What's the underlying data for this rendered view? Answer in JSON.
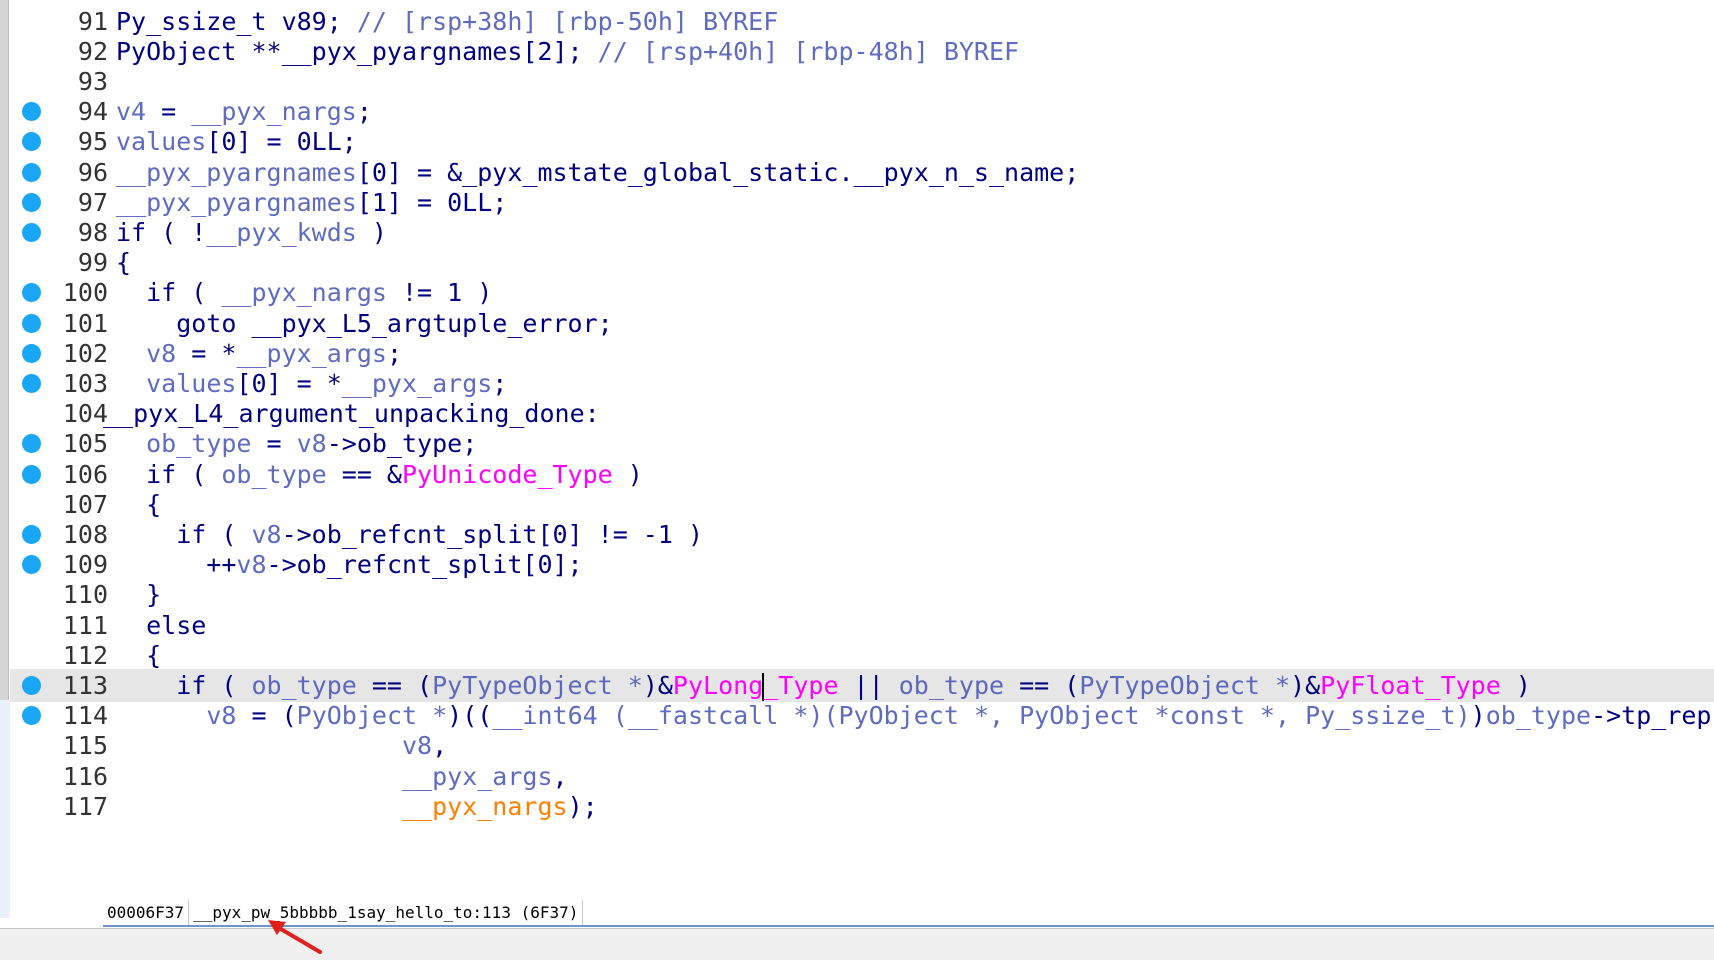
{
  "status_bar": {
    "address": "00006F37",
    "location": "__pyx_pw_5bbbbb_1say_hello_to:113 (6F37)"
  },
  "colors": {
    "breakpoint": "#19a7f5",
    "keyword": "#000080",
    "variable": "#4a57b8",
    "type_name": "#ff00ff",
    "argument": "#ff7f00",
    "current_line": "#e6e6e6"
  },
  "code_lines": [
    {
      "n": "91",
      "bp": false,
      "tokens": [
        [
          "Py_ssize_t v89; ",
          "kw"
        ],
        [
          "// [rsp+38h] [rbp-50h] BYREF",
          "com"
        ]
      ]
    },
    {
      "n": "92",
      "bp": false,
      "tokens": [
        [
          "PyObject **__pyx_pyargnames[2]; ",
          "kw"
        ],
        [
          "// [rsp+40h] [rbp-48h] BYREF",
          "com"
        ]
      ]
    },
    {
      "n": "93",
      "bp": false,
      "tokens": []
    },
    {
      "n": "94",
      "bp": true,
      "tokens": [
        [
          "v4",
          "var"
        ],
        [
          " = ",
          "kw"
        ],
        [
          "__pyx_nargs",
          "var"
        ],
        [
          ";",
          "kw"
        ]
      ]
    },
    {
      "n": "95",
      "bp": true,
      "tokens": [
        [
          "values",
          "var"
        ],
        [
          "[0] = 0LL;",
          "kw"
        ]
      ]
    },
    {
      "n": "96",
      "bp": true,
      "tokens": [
        [
          "__pyx_pyargnames",
          "var"
        ],
        [
          "[0] = &_pyx_mstate_global_static.__pyx_n_s_name;",
          "kw"
        ]
      ]
    },
    {
      "n": "97",
      "bp": true,
      "tokens": [
        [
          "__pyx_pyargnames",
          "var"
        ],
        [
          "[1] = 0LL;",
          "kw"
        ]
      ]
    },
    {
      "n": "98",
      "bp": true,
      "tokens": [
        [
          "if ( !",
          "kw"
        ],
        [
          "__pyx_kwds",
          "var"
        ],
        [
          " )",
          "kw"
        ]
      ]
    },
    {
      "n": "99",
      "bp": false,
      "tokens": [
        [
          "{",
          "kw"
        ]
      ]
    },
    {
      "n": "100",
      "bp": true,
      "tokens": [
        [
          "  if ( ",
          "kw"
        ],
        [
          "__pyx_nargs",
          "var"
        ],
        [
          " != 1 )",
          "kw"
        ]
      ]
    },
    {
      "n": "101",
      "bp": true,
      "tokens": [
        [
          "    goto __pyx_L5_argtuple_error;",
          "kw"
        ]
      ]
    },
    {
      "n": "102",
      "bp": true,
      "tokens": [
        [
          "  ",
          "kw"
        ],
        [
          "v8",
          "var"
        ],
        [
          " = *",
          "kw"
        ],
        [
          "__pyx_args",
          "var"
        ],
        [
          ";",
          "kw"
        ]
      ]
    },
    {
      "n": "103",
      "bp": true,
      "tokens": [
        [
          "  ",
          "kw"
        ],
        [
          "values",
          "var"
        ],
        [
          "[0] = *",
          "kw"
        ],
        [
          "__pyx_args",
          "var"
        ],
        [
          ";",
          "kw"
        ]
      ]
    },
    {
      "n": "104",
      "bp": false,
      "label": true,
      "tokens": [
        [
          "__pyx_L4_argument_unpacking_done:",
          "kw"
        ]
      ]
    },
    {
      "n": "105",
      "bp": true,
      "tokens": [
        [
          "  ",
          "kw"
        ],
        [
          "ob_type",
          "var"
        ],
        [
          " = ",
          "kw"
        ],
        [
          "v8",
          "var"
        ],
        [
          "->ob_type;",
          "kw"
        ]
      ]
    },
    {
      "n": "106",
      "bp": true,
      "tokens": [
        [
          "  if ( ",
          "kw"
        ],
        [
          "ob_type",
          "var"
        ],
        [
          " == &",
          "kw"
        ],
        [
          "PyUnicode_Type",
          "type"
        ],
        [
          " )",
          "kw"
        ]
      ]
    },
    {
      "n": "107",
      "bp": false,
      "tokens": [
        [
          "  {",
          "kw"
        ]
      ]
    },
    {
      "n": "108",
      "bp": true,
      "tokens": [
        [
          "    if ( ",
          "kw"
        ],
        [
          "v8",
          "var"
        ],
        [
          "->ob_refcnt_split[0] != -1 )",
          "kw"
        ]
      ]
    },
    {
      "n": "109",
      "bp": true,
      "tokens": [
        [
          "      ++",
          "kw"
        ],
        [
          "v8",
          "var"
        ],
        [
          "->ob_refcnt_split[0];",
          "kw"
        ]
      ]
    },
    {
      "n": "110",
      "bp": false,
      "tokens": [
        [
          "  }",
          "kw"
        ]
      ]
    },
    {
      "n": "111",
      "bp": false,
      "tokens": [
        [
          "  else",
          "kw"
        ]
      ]
    },
    {
      "n": "112",
      "bp": false,
      "tokens": [
        [
          "  {",
          "kw"
        ]
      ]
    },
    {
      "n": "113",
      "bp": true,
      "current": true,
      "tokens": [
        [
          "    if ( ",
          "kw"
        ],
        [
          "ob_type",
          "var"
        ],
        [
          " == (",
          "kw"
        ],
        [
          "PyTypeObject *",
          "var"
        ],
        [
          ")&",
          "kw"
        ],
        [
          "PyLong",
          "type"
        ],
        [
          "|",
          "caret"
        ],
        [
          "_Type",
          "type"
        ],
        [
          " || ",
          "kw"
        ],
        [
          "ob_type",
          "var"
        ],
        [
          " == (",
          "kw"
        ],
        [
          "PyTypeObject *",
          "var"
        ],
        [
          ")&",
          "kw"
        ],
        [
          "PyFloat_Type",
          "type"
        ],
        [
          " )",
          "kw"
        ]
      ]
    },
    {
      "n": "114",
      "bp": true,
      "tokens": [
        [
          "      ",
          "kw"
        ],
        [
          "v8",
          "var"
        ],
        [
          " = (",
          "kw"
        ],
        [
          "PyObject *",
          "var"
        ],
        [
          ")((",
          "kw"
        ],
        [
          "__int64 (__fastcall *)(PyObject *, PyObject *const *, Py_ssize_t)",
          "var"
        ],
        [
          ")",
          "kw"
        ],
        [
          "ob_type",
          "var"
        ],
        [
          "->tp_repr)(",
          "kw"
        ]
      ]
    },
    {
      "n": "115",
      "bp": false,
      "tokens": [
        [
          "                   ",
          "kw"
        ],
        [
          "v8",
          "var"
        ],
        [
          ",",
          "kw"
        ]
      ]
    },
    {
      "n": "116",
      "bp": false,
      "tokens": [
        [
          "                   ",
          "kw"
        ],
        [
          "__pyx_args",
          "var"
        ],
        [
          ",",
          "kw"
        ]
      ]
    },
    {
      "n": "117",
      "bp": false,
      "tokens": [
        [
          "                   ",
          "kw"
        ],
        [
          "__pyx_nargs",
          "arg"
        ],
        [
          ");",
          "kw"
        ]
      ]
    }
  ]
}
